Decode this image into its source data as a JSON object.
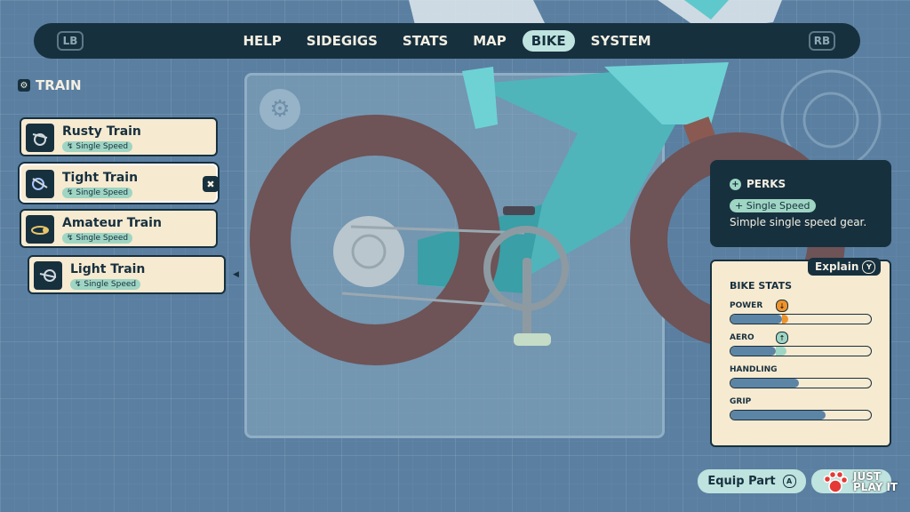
{
  "nav": {
    "left_bumper": "LB",
    "right_bumper": "RB",
    "tabs": [
      {
        "label": "HELP"
      },
      {
        "label": "SIDEGIGS"
      },
      {
        "label": "STATS"
      },
      {
        "label": "MAP"
      },
      {
        "label": "BIKE",
        "active": true
      },
      {
        "label": "SYSTEM"
      }
    ]
  },
  "section": {
    "title": "TRAIN"
  },
  "parts": [
    {
      "name": "Rusty Train",
      "tag": "Single Speed"
    },
    {
      "name": "Tight Train",
      "tag": "Single Speed",
      "selected": true
    },
    {
      "name": "Amateur Train",
      "tag": "Single Speed"
    },
    {
      "name": "Light Train",
      "tag": "Single Speed"
    }
  ],
  "perks": {
    "title": "PERKS",
    "tag": "+ Single Speed",
    "description": "Simple single speed gear."
  },
  "stats": {
    "explain_label": "Explain",
    "explain_button": "Y",
    "title": "BIKE STATS",
    "items": [
      {
        "label": "POWER",
        "value": 0.37,
        "delta": 0.04,
        "delta_dir": "down",
        "delta_color": "#f0932b"
      },
      {
        "label": "AERO",
        "value": 0.32,
        "delta": 0.08,
        "delta_dir": "up",
        "delta_color": "#9ed5c3"
      },
      {
        "label": "HANDLING",
        "value": 0.49
      },
      {
        "label": "GRIP",
        "value": 0.68
      }
    ]
  },
  "actions": {
    "equip_label": "Equip Part",
    "equip_button": "A"
  },
  "watermark": {
    "line1": "JUST",
    "line2": "PLAY IT"
  },
  "colors": {
    "background": "#5a7fa1",
    "navy": "#17303e",
    "cream": "#f6ead1",
    "mint": "#9ed5c3",
    "wheel": "#6e5357",
    "frame": "#5ec8cc"
  }
}
